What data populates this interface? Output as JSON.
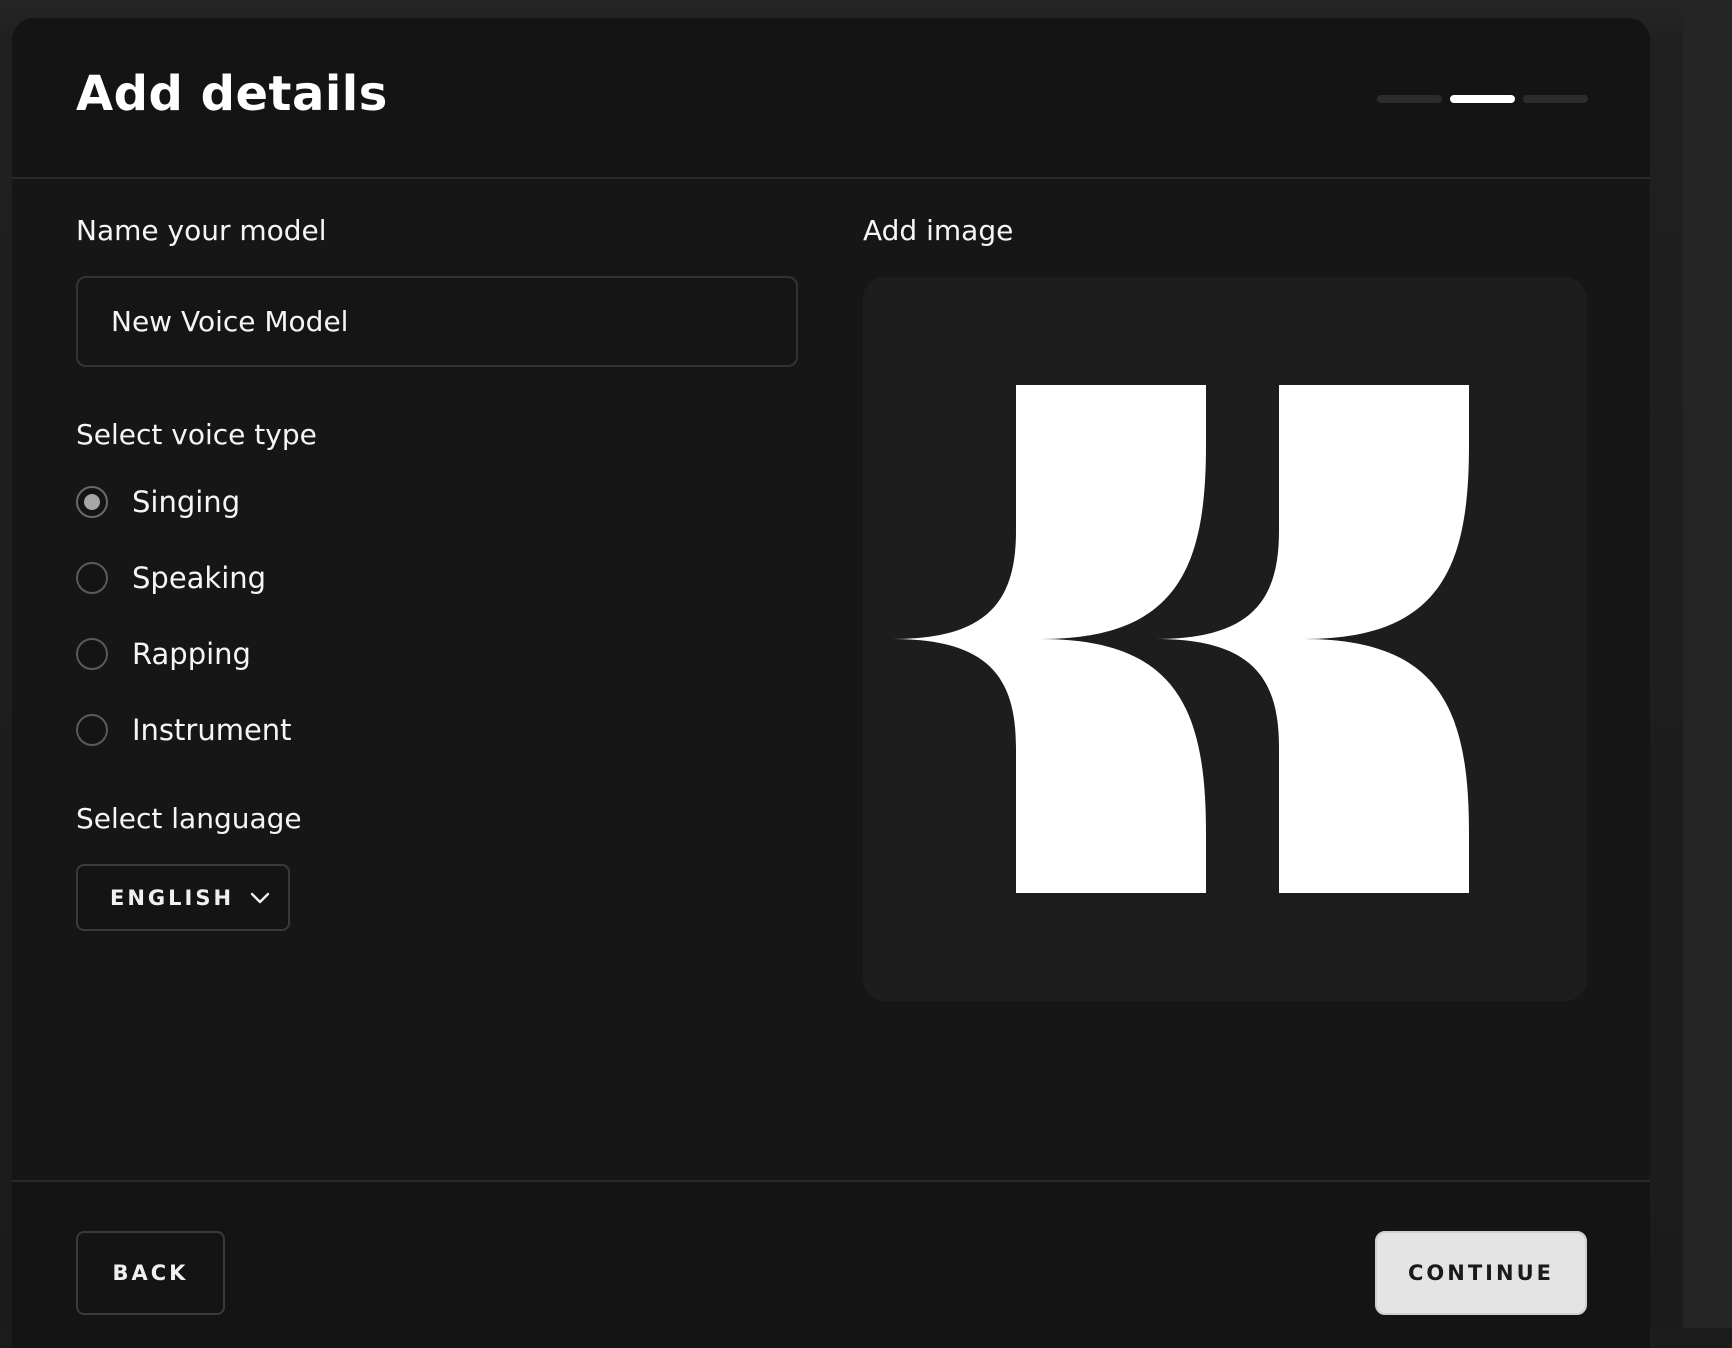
{
  "dialog": {
    "title": "Add details",
    "steps": {
      "total": 3,
      "current": 2
    }
  },
  "name_section": {
    "label": "Name your model",
    "value": "New Voice Model"
  },
  "voice_type": {
    "label": "Select voice type",
    "options": [
      {
        "label": "Singing",
        "selected": true
      },
      {
        "label": "Speaking",
        "selected": false
      },
      {
        "label": "Rapping",
        "selected": false
      },
      {
        "label": "Instrument",
        "selected": false
      }
    ]
  },
  "language": {
    "label": "Select language",
    "value": "ENGLISH",
    "icon": "chevron-down-icon"
  },
  "image_section": {
    "label": "Add image",
    "image": "model-logo-image"
  },
  "footer": {
    "back_label": "BACK",
    "continue_label": "CONTINUE"
  },
  "colors": {
    "background": "#161616",
    "accent": "#ffffff",
    "primary_button": "#e4e4e4"
  }
}
